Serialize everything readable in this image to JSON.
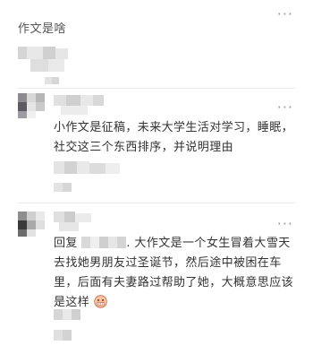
{
  "post_fragment": "作文是啥",
  "more_icon": "more-icon",
  "comments": [
    {
      "text": "小作文是征稿，未来大学生活对学习，睡眠，社交这三个东西排序，并说明理由"
    },
    {
      "reply_prefix": "回复",
      "reply_suffix": ". 大作文是一个女生冒着大雪天去找她男朋友过圣诞节，然后途中被困在车里，后面有夫妻路过帮助了她，大概意思应该是这样",
      "emoji": "grimace-emoji"
    }
  ]
}
